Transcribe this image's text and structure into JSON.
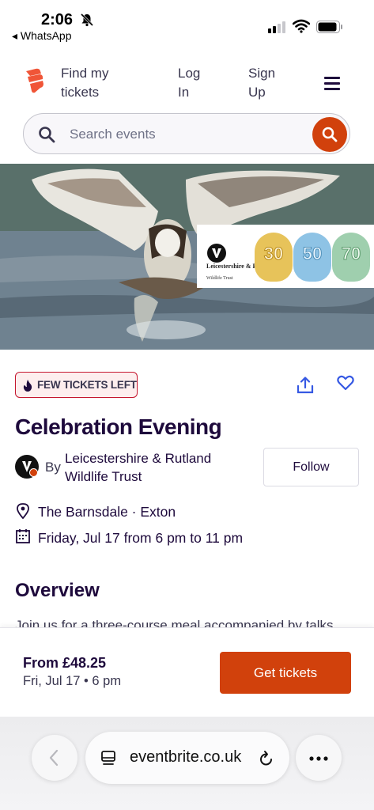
{
  "status_bar": {
    "time": "2:06",
    "back_app": "◂ WhatsApp"
  },
  "header": {
    "find_tickets": "Find my tickets",
    "log_in": "Log In",
    "sign_up": "Sign Up"
  },
  "search": {
    "placeholder": "Search events"
  },
  "hero": {
    "org_logo_text": "Leicestershire & Rutland",
    "org_logo_sub": "Wildlife Trust",
    "anniversary_badges": [
      "30",
      "50",
      "70"
    ]
  },
  "event": {
    "tag": "FEW TICKETS LEFT",
    "title": "Celebration Evening",
    "by_label": "By",
    "organizer": "Leicestershire & Rutland Wildlife Trust",
    "follow_label": "Follow",
    "location": "The Barnsdale · Exton",
    "date": "Friday, Jul 17 from 6 pm to 11 pm",
    "overview_heading": "Overview",
    "overview_text": "Join us for a three-course meal accompanied by talks"
  },
  "purchase": {
    "price": "From £48.25",
    "datetime": "Fri, Jul 17 • 6 pm",
    "button_label": "Get tickets"
  },
  "browser": {
    "url": "eventbrite.co.uk"
  },
  "colors": {
    "brand_orange": "#d1410c",
    "text_dark": "#1e0a3c",
    "link_blue": "#3659e3",
    "tag_red": "#c5162e"
  }
}
